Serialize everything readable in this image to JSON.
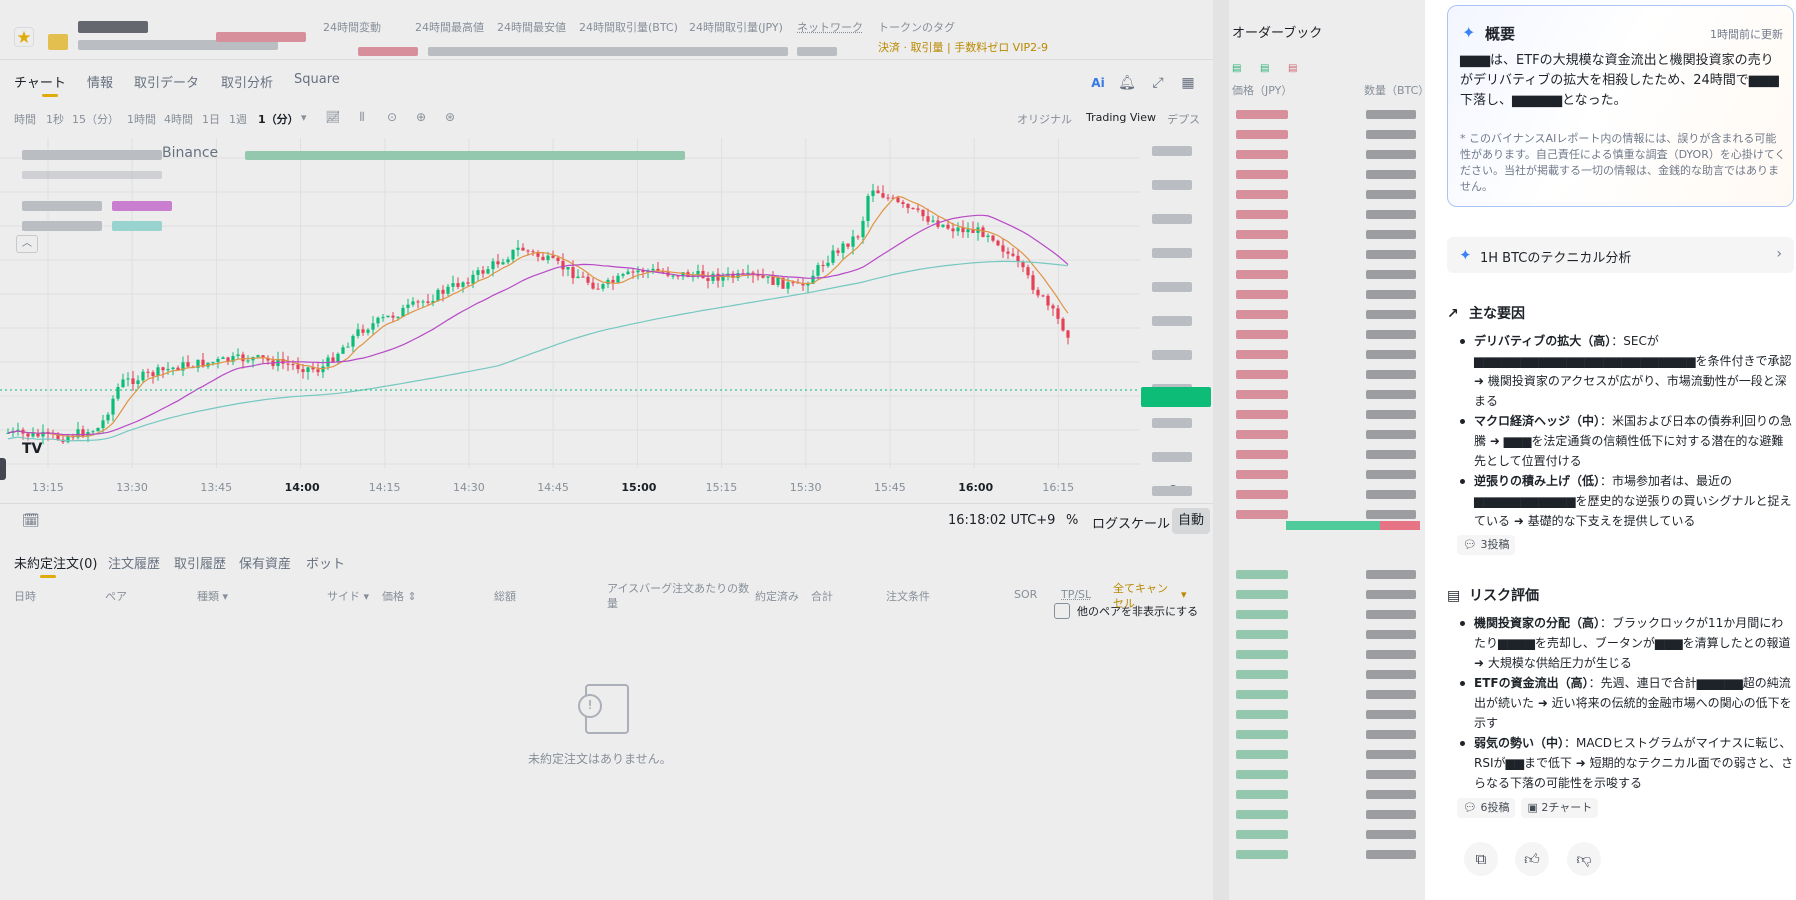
{
  "ticker": {
    "stats": [
      "24時間変動",
      "24時間最高値",
      "24時間最安値",
      "24時間取引量(BTC)",
      "24時間取引量(JPY)",
      "ネットワーク",
      "トークンのタグ"
    ],
    "tag_sub": "決済 · 取引量 | 手数料ゼロ VIP2-9"
  },
  "tabs": {
    "items": [
      "チャート",
      "情報",
      "取引データ",
      "取引分析",
      "Square"
    ],
    "active": "チャート"
  },
  "timeframes": {
    "items": [
      "時間",
      "1秒",
      "15（分）",
      "1時間",
      "4時間",
      "1日",
      "1週"
    ],
    "selected": "1（分）",
    "views": [
      "オリジナル",
      "Trading View",
      "デプス"
    ]
  },
  "chart": {
    "source": "Binance",
    "time_ticks": [
      "13:15",
      "13:30",
      "13:45",
      "14:00",
      "14:15",
      "14:30",
      "14:45",
      "15:00",
      "15:15",
      "15:30",
      "15:45",
      "16:00",
      "16:15"
    ],
    "bold_ticks": [
      "14:00",
      "15:00",
      "16:00"
    ],
    "tv_logo": "TV",
    "clock": "16:18:02 UTC+9",
    "percent": "%",
    "log_scale": "ログスケール",
    "auto": "自動",
    "colors": {
      "up": "#0ecb81",
      "down": "#f6465d",
      "ma_short": "#f0a04b",
      "ma_mid": "#c64fd6",
      "ma_long": "#7fd8d0"
    }
  },
  "orders": {
    "tabs": [
      "未約定注文(0)",
      "注文履歴",
      "取引履歴",
      "保有資産",
      "ボット"
    ],
    "hide_other": "他のペアを非表示にする",
    "columns": [
      "日時",
      "ペア",
      "種類 ▾",
      "サイド ▾",
      "価格 ⇕",
      "総額",
      "アイスバーグ注文あたりの数量",
      "約定済み",
      "合計",
      "注文条件",
      "SOR",
      "TP/SL"
    ],
    "cancel_all": "全てキャンセル",
    "empty": "未約定注文はありません。"
  },
  "orderbook": {
    "title": "オーダーブック",
    "col_price": "価格（JPY）",
    "col_qty": "数量（BTC）"
  },
  "ai": {
    "summary": {
      "title": "概要",
      "updated": "1時間前に更新",
      "body": "▆▆▆は、ETFの大規模な資金流出と機関投資家の売りがデリバティブの拡大を相殺したため、24時間で▆▆▆下落し、▆▆▆▆▆となった。",
      "disclaimer": "このバイナンスAIレポート内の情報には、誤りが含まれる可能性があります。自己責任による慎重な調査（DYOR）を心掛けてください。当社が掲載する一切の情報は、金銭的な助言ではありません。"
    },
    "technical_link": "1H BTCのテクニカル分析",
    "factors": {
      "title": "主な要因",
      "items": [
        {
          "title": "デリバティブの拡大（高）",
          "text": "：SECが▆▆▆▆▆▆▆▆▆▆▆▆▆▆▆▆▆▆▆▆▆▆▆▆を条件付きで承認 ➜ 機関投資家のアクセスが広がり、市場流動性が一段と深まる"
        },
        {
          "title": "マクロ経済ヘッジ（中）",
          "text": "：米国および日本の債券利回りの急騰 ➜ ▆▆▆を法定通貨の信頼性低下に対する潜在的な避難先として位置付ける"
        },
        {
          "title": "逆張りの積み上げ（低）",
          "text": "：市場参加者は、最近の▆▆▆▆▆▆▆▆▆▆▆を歴史的な逆張りの買いシグナルと捉えている ➜ 基礎的な下支えを提供している"
        }
      ],
      "chips": [
        "3投稿"
      ]
    },
    "risks": {
      "title": "リスク評価",
      "items": [
        {
          "title": "機関投資家の分配（高）",
          "text": "：ブラックロックが11か月間にわたり▆▆▆▆を売却し、ブータンが▆▆▆を清算したとの報道 ➜ 大規模な供給圧力が生じる"
        },
        {
          "title": "ETFの資金流出（高）",
          "text": "：先週、連日で合計▆▆▆▆▆超の純流出が続いた ➜ 近い将来の伝統的金融市場への関心の低下を示す"
        },
        {
          "title": "弱気の勢い（中）",
          "text": "：MACDヒストグラムがマイナスに転じ、RSIが▆▆まで低下 ➜ 短期的なテクニカル面での弱さと、さらなる下落の可能性を示唆する"
        }
      ],
      "chips": [
        "6投稿",
        "2チャート"
      ]
    },
    "actions": [
      "copy-icon",
      "thumbs-up-icon",
      "thumbs-down-icon"
    ]
  }
}
